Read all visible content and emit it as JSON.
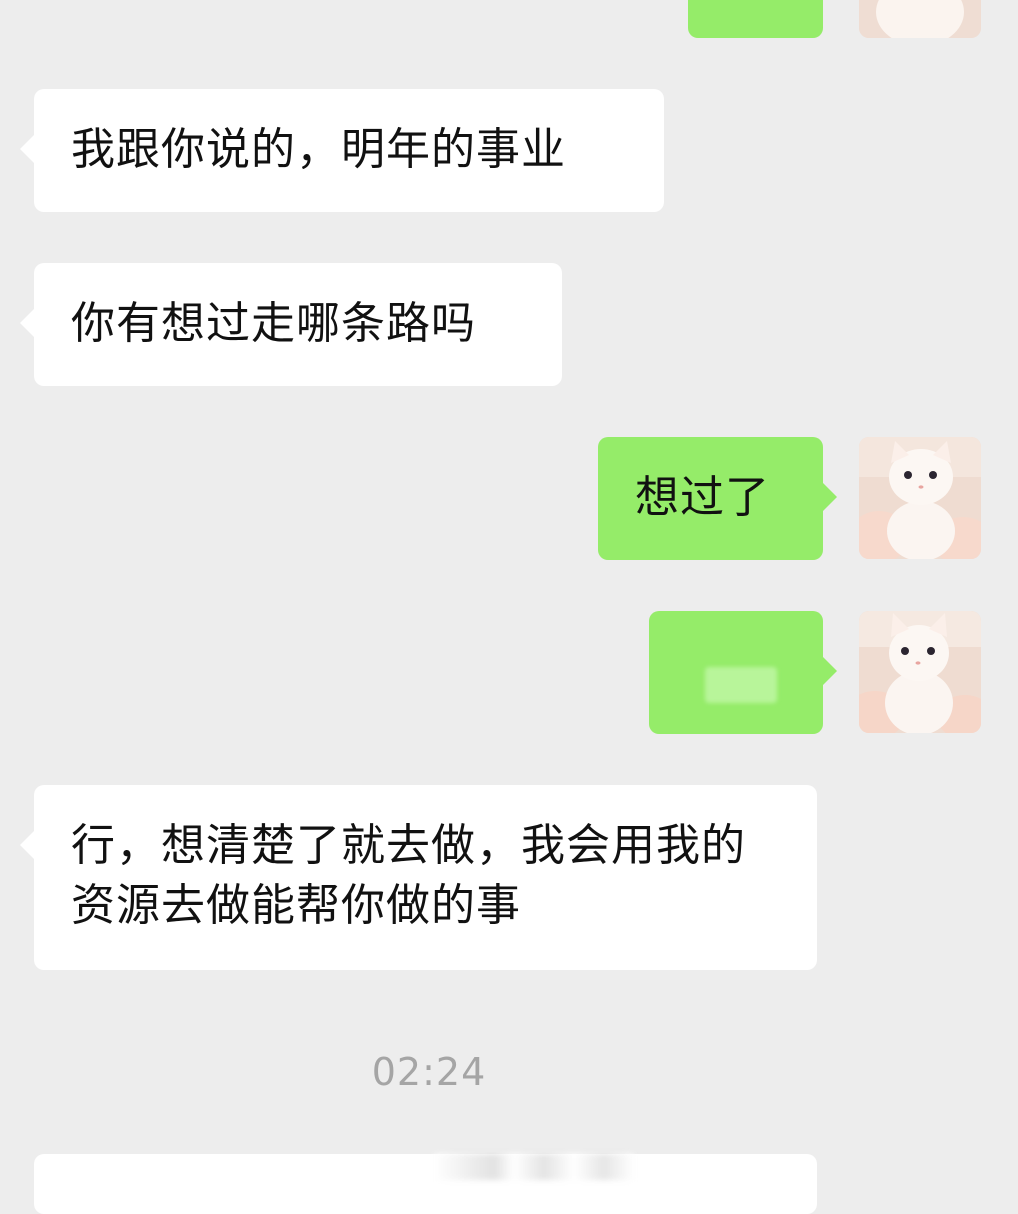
{
  "messages": [
    {
      "id": "m1",
      "direction": "incoming",
      "text": "我跟你说的，明年的事业"
    },
    {
      "id": "m2",
      "direction": "incoming",
      "text": "你有想过走哪条路吗"
    },
    {
      "id": "m3",
      "direction": "outgoing",
      "text": "想过了"
    },
    {
      "id": "m4",
      "direction": "outgoing",
      "text": ""
    },
    {
      "id": "m5",
      "direction": "incoming",
      "text": "行，想清楚了就去做，我会用我的资源去做能帮你做的事"
    }
  ],
  "timestamp": "02:24",
  "colors": {
    "background": "#ededed",
    "incoming_bubble": "#ffffff",
    "outgoing_bubble": "#95ec69",
    "timestamp_text": "#a5a5a5"
  },
  "icons": {
    "avatar": "cat-avatar-icon"
  }
}
